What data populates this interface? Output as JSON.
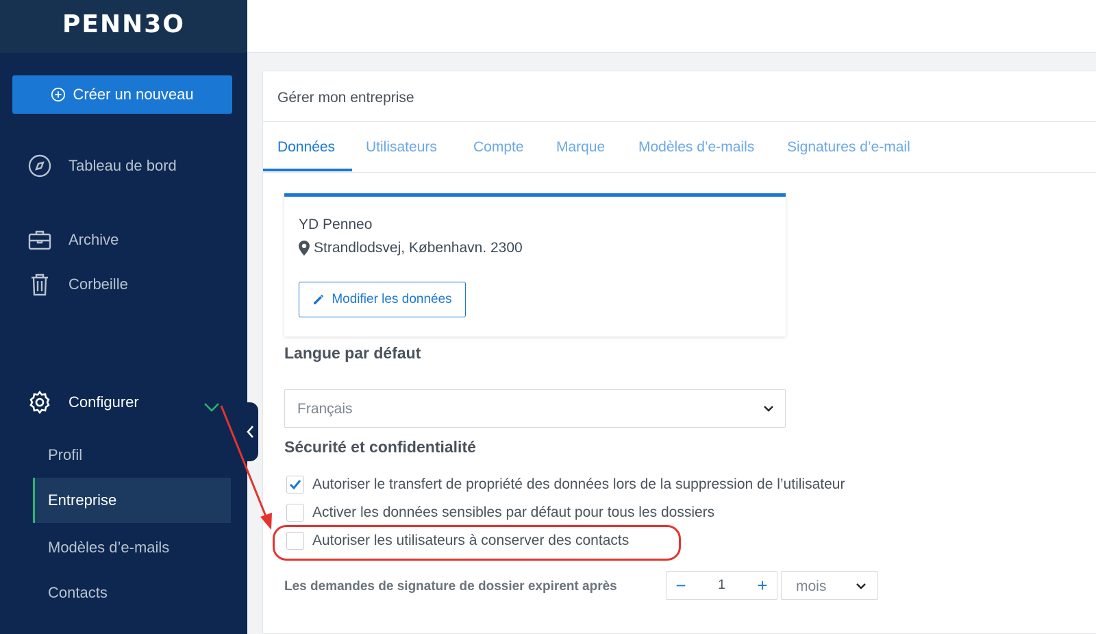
{
  "sidebar": {
    "logo": "PENN3O",
    "create_button": "Créer un nouveau",
    "nav": {
      "dashboard": "Tableau de bord",
      "archive": "Archive",
      "trash": "Corbeille",
      "configure": "Configurer"
    },
    "sub_items": {
      "profile": "Profil",
      "company": "Entreprise",
      "email_templates": "Modèles d’e-mails",
      "contacts": "Contacts"
    }
  },
  "panel": {
    "title": "Gérer mon entreprise",
    "tabs": [
      "Données",
      "Utilisateurs",
      "Compte",
      "Marque",
      "Modèles d’e-mails",
      "Signatures d’e-mail"
    ],
    "active_tab": "Données"
  },
  "company": {
    "name": "YD Penneo",
    "address": "Strandlodsvej, København. 2300",
    "edit_button": "Modifier les données"
  },
  "language": {
    "heading": "Langue par défaut",
    "selected": "Français"
  },
  "security": {
    "heading": "Sécurité et confidentialité",
    "options": [
      {
        "label": "Autoriser le transfert de propriété des données lors de la suppression de l’utilisateur",
        "checked": true
      },
      {
        "label": "Activer les données sensibles par défaut pour tous les dossiers",
        "checked": false
      },
      {
        "label": "Autoriser les utilisateurs à conserver des contacts",
        "checked": false
      }
    ],
    "expiry_label": "Les demandes de signature de dossier expirent après",
    "expiry_value": "1",
    "expiry_unit": "mois",
    "minus": "−",
    "plus": "+"
  },
  "colors": {
    "sidebar_bg": "#0d2750",
    "accent": "#1a77d4",
    "highlight": "#e3342f",
    "active_indicator": "#2bb673"
  }
}
